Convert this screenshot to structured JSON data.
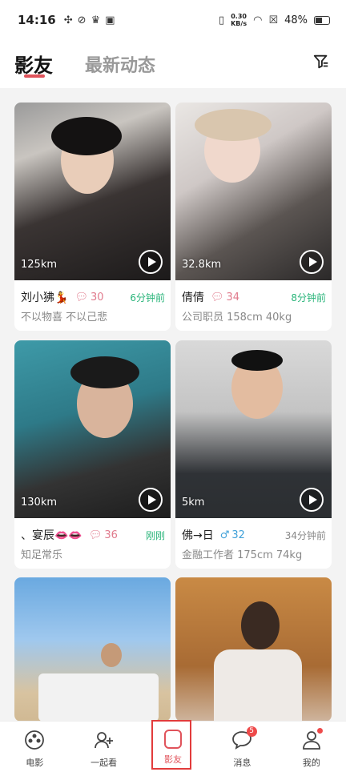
{
  "status_bar": {
    "time": "14:16",
    "net_speed": "0.30",
    "net_unit": "KB/s",
    "battery": "48%"
  },
  "header": {
    "tab_active": "影友",
    "tab_inactive": "最新动态",
    "accent_color": "#e0535b"
  },
  "cards": [
    {
      "distance": "125km",
      "name": "刘小狒💃",
      "comments": "30",
      "gender": "female",
      "time": "6分钟前",
      "time_color": "green",
      "subtitle": "不以物喜   不以己悲"
    },
    {
      "distance": "32.8km",
      "name": "倩倩",
      "comments": "34",
      "gender": "female",
      "time": "8分钟前",
      "time_color": "green",
      "subtitle": "公司职员 158cm 40kg"
    },
    {
      "distance": "130km",
      "name": "、宴辰👄👄",
      "comments": "36",
      "gender": "female",
      "time": "刚刚",
      "time_color": "green",
      "subtitle": "知足常乐"
    },
    {
      "distance": "5km",
      "name": "佛→日",
      "comments": "32",
      "gender": "male",
      "time": "34分钟前",
      "time_color": "grey",
      "subtitle": "金融工作者 175cm 74kg"
    },
    {
      "distance": "",
      "name": "",
      "comments": "",
      "gender": "",
      "time": "",
      "subtitle": ""
    },
    {
      "distance": "",
      "name": "",
      "comments": "",
      "gender": "",
      "time": "",
      "subtitle": ""
    }
  ],
  "bottom_nav": {
    "items": [
      {
        "label": "电影",
        "icon": "film-reel-icon"
      },
      {
        "label": "一起看",
        "icon": "people-add-icon"
      },
      {
        "label": "影友",
        "icon": "rounded-square-icon"
      },
      {
        "label": "消息",
        "icon": "chat-bubble-icon",
        "badge": "5"
      },
      {
        "label": "我的",
        "icon": "person-icon"
      }
    ]
  }
}
